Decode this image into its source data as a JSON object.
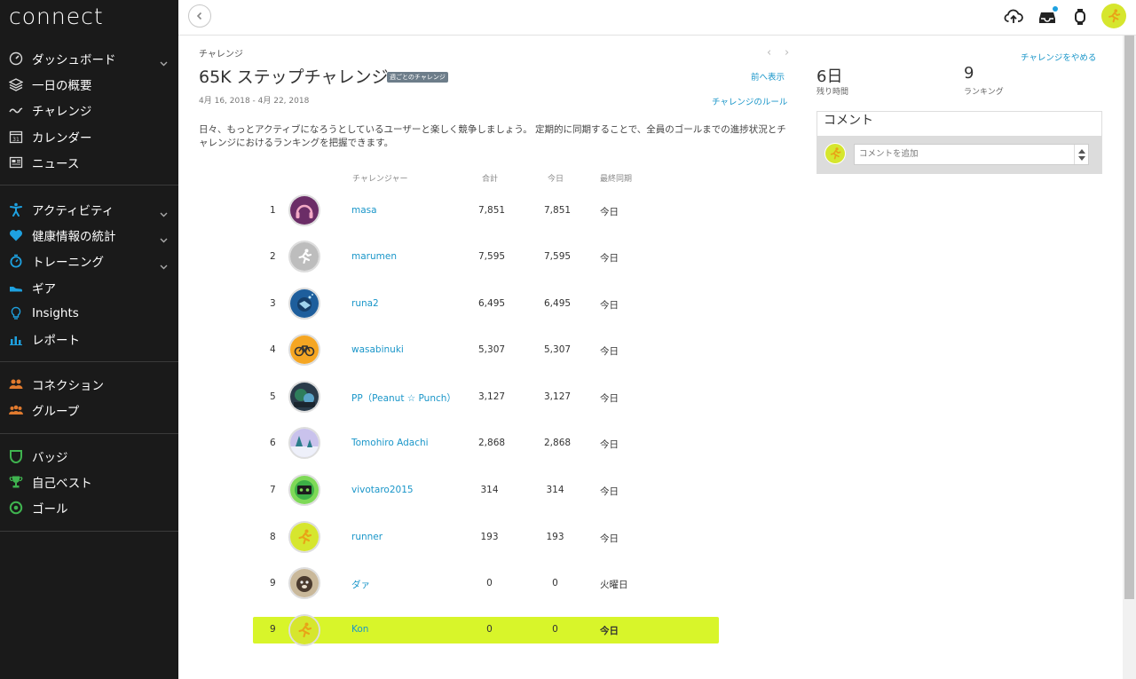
{
  "app": {
    "logo": "connect"
  },
  "sidebar": {
    "groups": [
      [
        {
          "label": "ダッシュボード",
          "icon": "speedometer-icon",
          "chevron": true
        },
        {
          "label": "一日の概要",
          "icon": "layers-icon",
          "chevron": false
        },
        {
          "label": "チャレンジ",
          "icon": "wave-icon",
          "chevron": false
        },
        {
          "label": "カレンダー",
          "icon": "calendar-icon",
          "chevron": false
        },
        {
          "label": "ニュース",
          "icon": "newspaper-icon",
          "chevron": false
        }
      ],
      [
        {
          "label": "アクティビティ",
          "icon": "activity-person-icon",
          "chevron": true
        },
        {
          "label": "健康情報の統計",
          "icon": "heart-icon",
          "chevron": true
        },
        {
          "label": "トレーニング",
          "icon": "stopwatch-icon",
          "chevron": true
        },
        {
          "label": "ギア",
          "icon": "shoe-icon",
          "chevron": false
        },
        {
          "label": "Insights",
          "icon": "lightbulb-icon",
          "chevron": false
        },
        {
          "label": "レポート",
          "icon": "bar-chart-icon",
          "chevron": false
        }
      ],
      [
        {
          "label": "コネクション",
          "icon": "connections-icon",
          "chevron": false
        },
        {
          "label": "グループ",
          "icon": "group-icon",
          "chevron": false
        }
      ],
      [
        {
          "label": "バッジ",
          "icon": "badge-shield-icon",
          "chevron": false
        },
        {
          "label": "自己ベスト",
          "icon": "trophy-icon",
          "chevron": false
        },
        {
          "label": "ゴール",
          "icon": "target-icon",
          "chevron": false
        }
      ]
    ],
    "colors": {
      "accent_blue": "#1ea1e0",
      "accent_orange": "#e07a2e",
      "accent_green": "#3fb34f"
    }
  },
  "page": {
    "breadcrumb": "チャレンジ",
    "title": "65K ステップチャレンジ",
    "badge": "週ごとのチャレンジ",
    "dates": "4月 16, 2018 - 4月 22, 2018",
    "prev_link": "前へ表示",
    "rules_link": "チャレンジのルール",
    "description": "日々、もっとアクティブになろうとしているユーザーと楽しく競争しましょう。 定期的に同期することで、全員のゴールまでの進捗状況とチャレンジにおけるランキングを把握できます。"
  },
  "table": {
    "headers": {
      "challenger": "チャレンジャー",
      "total": "合計",
      "today": "今日",
      "last_sync": "最終同期"
    },
    "rows": [
      {
        "rank": "1",
        "name": "masa",
        "total": "7,851",
        "today": "7,851",
        "sync": "今日",
        "avatar": "headphones-avatar"
      },
      {
        "rank": "2",
        "name": "marumen",
        "total": "7,595",
        "today": "7,595",
        "sync": "今日",
        "avatar": "runner-gray-avatar"
      },
      {
        "rank": "3",
        "name": "runa2",
        "total": "6,495",
        "today": "6,495",
        "sync": "今日",
        "avatar": "diver-avatar"
      },
      {
        "rank": "4",
        "name": "wasabinuki",
        "total": "5,307",
        "today": "5,307",
        "sync": "今日",
        "avatar": "bicycle-avatar"
      },
      {
        "rank": "5",
        "name": "PP（Peanut ☆ Punch）",
        "total": "3,127",
        "today": "3,127",
        "sync": "今日",
        "avatar": "photo-avatar"
      },
      {
        "rank": "6",
        "name": "Tomohiro Adachi",
        "total": "2,868",
        "today": "2,868",
        "sync": "今日",
        "avatar": "snow-trees-avatar"
      },
      {
        "rank": "7",
        "name": "vivotaro2015",
        "total": "314",
        "today": "314",
        "sync": "今日",
        "avatar": "cassette-avatar"
      },
      {
        "rank": "8",
        "name": "runner",
        "total": "193",
        "today": "193",
        "sync": "今日",
        "avatar": "runner-yellow-avatar"
      },
      {
        "rank": "9",
        "name": "ダァ",
        "total": "0",
        "today": "0",
        "sync": "火曜日",
        "avatar": "dog-avatar"
      }
    ],
    "me": {
      "rank": "9",
      "name": "Kon",
      "total": "0",
      "today": "0",
      "sync": "今日",
      "avatar": "runner-yellow-avatar"
    }
  },
  "side": {
    "quit_link": "チャレンジをやめる",
    "days_value": "6日",
    "days_label": "残り時間",
    "rank_value": "9",
    "rank_label": "ランキング",
    "comments_title": "コメント",
    "comment_placeholder": "コメントを追加"
  }
}
